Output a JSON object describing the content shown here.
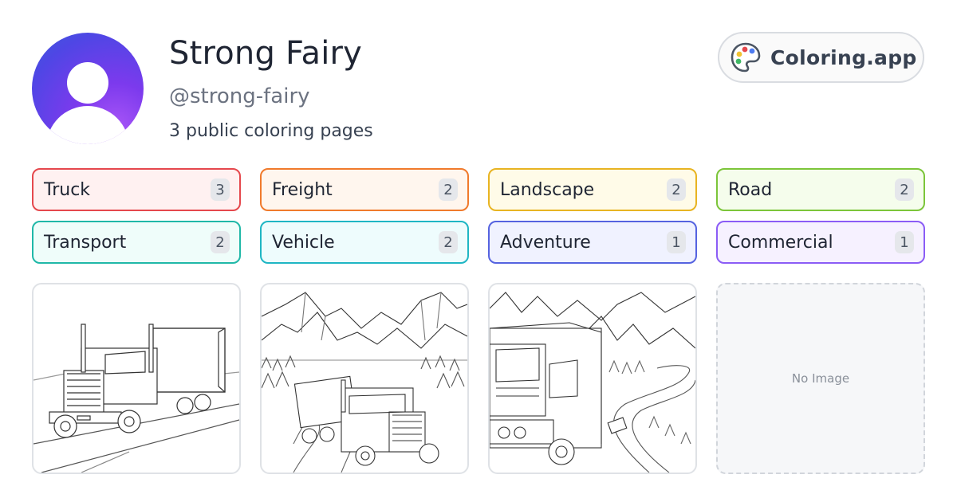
{
  "profile": {
    "name": "Strong Fairy",
    "handle": "@strong-fairy",
    "page_count_text": "3 public coloring pages"
  },
  "brand": {
    "label": "Coloring.app",
    "icon": "palette-icon"
  },
  "tags": [
    {
      "label": "Truck",
      "count": "3",
      "color": "#e5484d",
      "bg": "#fff1f1"
    },
    {
      "label": "Freight",
      "count": "2",
      "color": "#f07a2c",
      "bg": "#fff6ee"
    },
    {
      "label": "Landscape",
      "count": "2",
      "color": "#e8b422",
      "bg": "#fffbe8"
    },
    {
      "label": "Road",
      "count": "2",
      "color": "#7cc53a",
      "bg": "#f5fdec"
    },
    {
      "label": "Transport",
      "count": "2",
      "color": "#20b8a8",
      "bg": "#effdfa"
    },
    {
      "label": "Vehicle",
      "count": "2",
      "color": "#1fb6c4",
      "bg": "#eefcfd"
    },
    {
      "label": "Adventure",
      "count": "1",
      "color": "#5563e0",
      "bg": "#f0f2ff"
    },
    {
      "label": "Commercial",
      "count": "1",
      "color": "#8b5cf6",
      "bg": "#f6f1ff"
    }
  ],
  "cards": {
    "empty_label": "No Image"
  }
}
